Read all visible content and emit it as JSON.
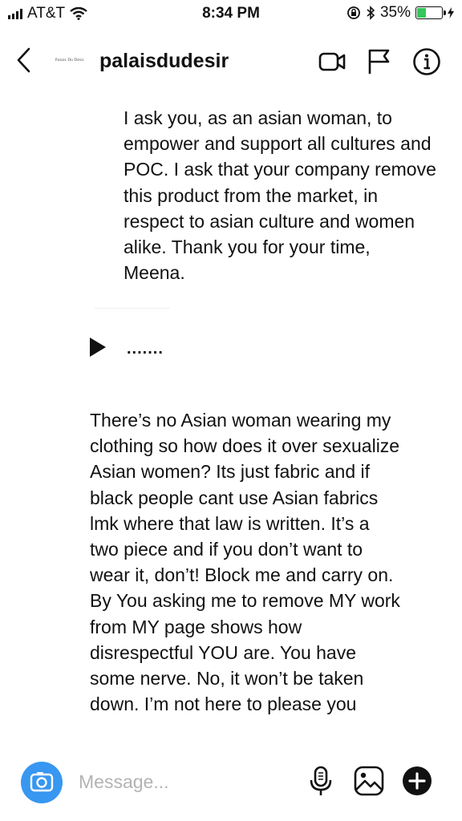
{
  "status_bar": {
    "carrier": "AT&T",
    "time": "8:34 PM",
    "battery": "35%"
  },
  "header": {
    "logo_text": "Palais Du Désir",
    "username": "palaisdudesir"
  },
  "messages": {
    "outgoing_text": "I ask you, as an asian woman, to empower and support all cultures and POC. I ask that your company remove this product from the market, in respect to asian culture and women alike. Thank you for your time, Meena.",
    "voice_waveform": ".......",
    "incoming_text": "There’s no Asian woman wearing my clothing so how does it over sexualize Asian women?  Its just fabric and if black people cant use Asian fabrics lmk where that law is written. It’s a two piece and if you don’t want to wear it, don’t! Block me and carry on. By You asking me to remove MY work from MY page shows how disrespectful YOU are. You have some nerve. No, it won’t be taken down. I’m not here to please you"
  },
  "composer": {
    "placeholder": "Message..."
  },
  "colors": {
    "accent": "#3897f0",
    "battery_fill": "#34c759"
  }
}
